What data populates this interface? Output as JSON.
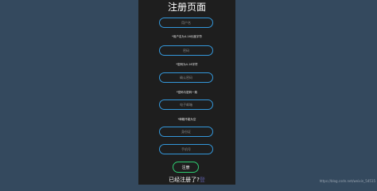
{
  "page": {
    "title": "注册页面"
  },
  "fields": [
    {
      "name": "username-field",
      "placeholder": "用户名"
    },
    {
      "name": "password-field",
      "placeholder": "密码"
    },
    {
      "name": "confirm-password-field",
      "placeholder": "确认密码"
    },
    {
      "name": "email-field",
      "placeholder": "电子邮箱"
    },
    {
      "name": "id-card-field",
      "placeholder": "身份证"
    },
    {
      "name": "phone-field",
      "placeholder": "手机号"
    }
  ],
  "hints": {
    "username": "*用户名为4-16长度字符",
    "password": "*密码为4-16字符",
    "confirm": "*密码与密码一致",
    "email": "*邮箱不能为空"
  },
  "submit_label": "注册",
  "login_link": {
    "text": "已经注册了?",
    "accent": "登"
  },
  "watermark": "https://blog.csdn.net/weixin_54515"
}
